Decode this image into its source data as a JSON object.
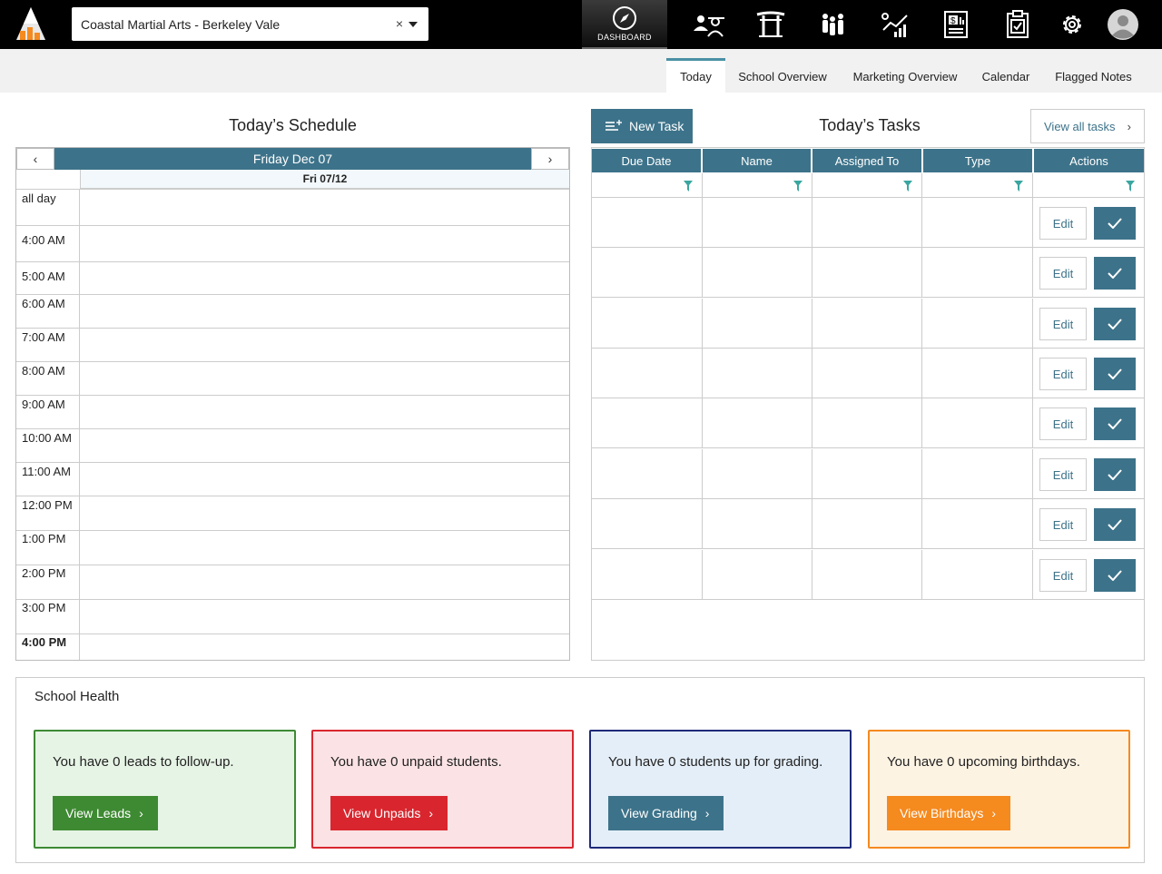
{
  "school": {
    "name": "Coastal Martial Arts - Berkeley Vale",
    "clear": "×"
  },
  "nav": {
    "dashboard_label": "DASHBOARD"
  },
  "tabs": [
    {
      "label": "Today"
    },
    {
      "label": "School Overview"
    },
    {
      "label": "Marketing Overview"
    },
    {
      "label": "Calendar"
    },
    {
      "label": "Flagged Notes"
    }
  ],
  "schedule": {
    "title": "Today’s Schedule",
    "date_label": "Friday Dec 07",
    "prev": "‹",
    "next": "›",
    "day_header": "Fri 07/12",
    "slots": [
      "all day",
      "4:00 AM",
      "5:00 AM",
      "6:00 AM",
      "7:00 AM",
      "8:00 AM",
      "9:00 AM",
      "10:00 AM",
      "11:00 AM",
      "12:00 PM",
      "1:00 PM",
      "2:00 PM",
      "3:00 PM",
      "4:00 PM"
    ]
  },
  "tasks": {
    "new_task_label": "New Task",
    "title": "Today’s Tasks",
    "view_all_label": "View all tasks",
    "view_all_chev": "›",
    "columns": [
      "Due Date",
      "Name",
      "Assigned To",
      "Type",
      "Actions"
    ],
    "edit_label": "Edit"
  },
  "health": {
    "title": "School Health",
    "cards": [
      {
        "message": "You have  0  leads to follow-up.",
        "button": "View Leads",
        "accent": "#3e8a33",
        "bg": "#e6f4e5"
      },
      {
        "message": "You have 0 unpaid students.",
        "button": "View Unpaids",
        "accent": "#d9262e",
        "bg": "#fbe2e4"
      },
      {
        "message": "You have  0  students up for grading.",
        "button": "View Grading",
        "accent": "#1e2a7a",
        "bg": "#e4eef8",
        "button_color": "#3d738a"
      },
      {
        "message": "You have  0  upcoming birthdays.",
        "button": "View Birthdays",
        "accent": "#f58a1f",
        "bg": "#fdf3e3"
      }
    ]
  },
  "colors": {
    "primary": "#3d738a",
    "filter_icon": "#3aa6a0"
  }
}
